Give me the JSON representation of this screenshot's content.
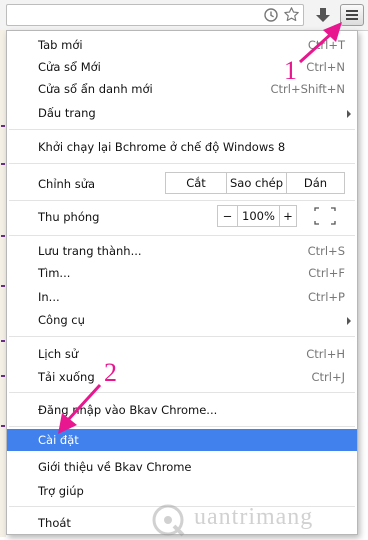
{
  "menu": {
    "items": [
      {
        "label": "Tab mới",
        "shortcut": "Ctrl+T"
      },
      {
        "label": "Cửa sổ Mới",
        "shortcut": "Ctrl+N"
      },
      {
        "label": "Cửa sổ ẩn danh mới",
        "shortcut": "Ctrl+Shift+N"
      },
      {
        "label": "Dấu trang",
        "submenu": true
      },
      {
        "label": "Khởi chạy lại Bchrome ở chế độ Windows 8"
      },
      {
        "label": "Chỉnh sửa"
      },
      {
        "label": "Thu phóng"
      },
      {
        "label": "Lưu trang thành...",
        "shortcut": "Ctrl+S"
      },
      {
        "label": "Tìm...",
        "shortcut": "Ctrl+F"
      },
      {
        "label": "In...",
        "shortcut": "Ctrl+P"
      },
      {
        "label": "Công cụ",
        "submenu": true
      },
      {
        "label": "Lịch sử",
        "shortcut": "Ctrl+H"
      },
      {
        "label": "Tải xuống",
        "shortcut": "Ctrl+J"
      },
      {
        "label": "Đăng nhập vào Bkav Chrome..."
      },
      {
        "label": "Cài đặt",
        "highlighted": true
      },
      {
        "label": "Giới thiệu về Bkav Chrome"
      },
      {
        "label": "Trợ giúp"
      },
      {
        "label": "Thoát"
      }
    ],
    "edit_buttons": [
      "Cắt",
      "Sao chép",
      "Dán"
    ],
    "zoom": {
      "minus": "−",
      "value": "100%",
      "plus": "+"
    }
  },
  "annotations": {
    "step1": "1",
    "step2": "2"
  },
  "watermark": {
    "text": "uantrimang"
  },
  "colors": {
    "highlight": "#4181ee",
    "annotation": "#e8178f"
  }
}
